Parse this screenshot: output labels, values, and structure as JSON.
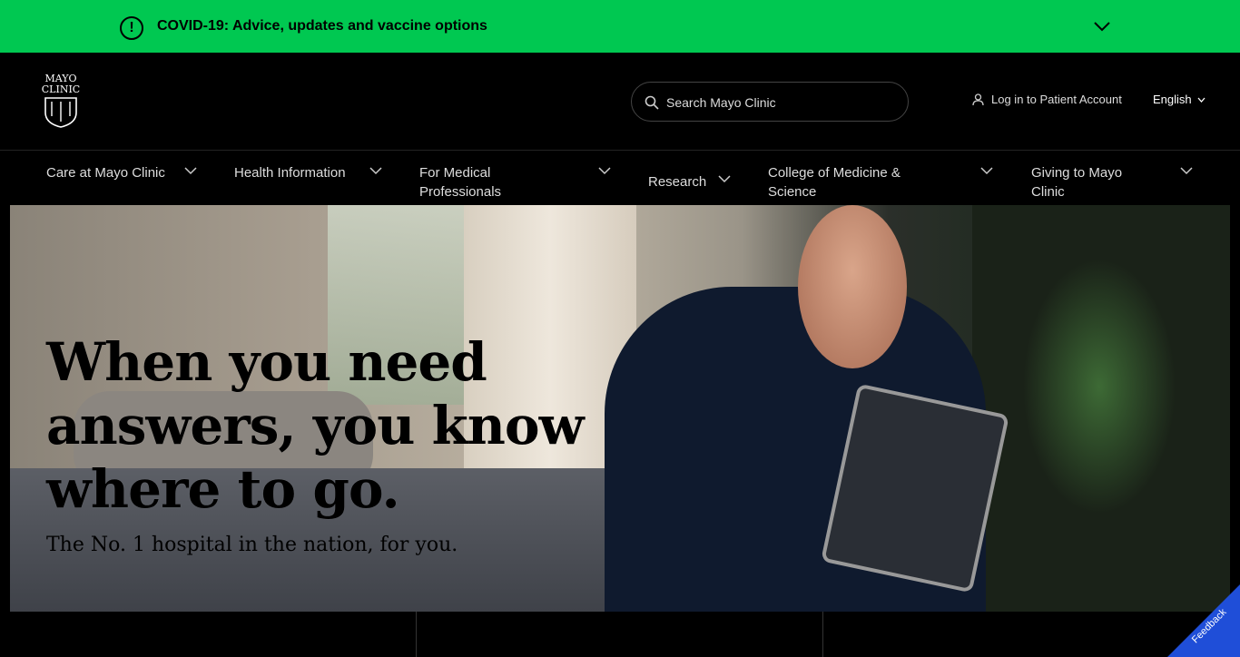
{
  "covid_banner": {
    "text": "COVID-19: Advice, updates and vaccine options",
    "background": "#00c851"
  },
  "header": {
    "logo_text": "MAYO CLINIC",
    "search": {
      "placeholder": "Search Mayo Clinic"
    },
    "login_label": "Log in to Patient Account",
    "language_label": "English"
  },
  "nav": {
    "items": [
      {
        "label": "Care at Mayo Clinic"
      },
      {
        "label": "Health Information"
      },
      {
        "label": "For Medical Professionals"
      },
      {
        "label": "Research"
      },
      {
        "label": "College of Medicine & Science"
      },
      {
        "label": "Giving to Mayo Clinic"
      }
    ]
  },
  "hero": {
    "title": "When you need answers, you know where to go.",
    "subtitle": "The No. 1 hospital in the nation, for you."
  },
  "feedback": {
    "label": "Feedback",
    "color": "#1f4ed8"
  }
}
